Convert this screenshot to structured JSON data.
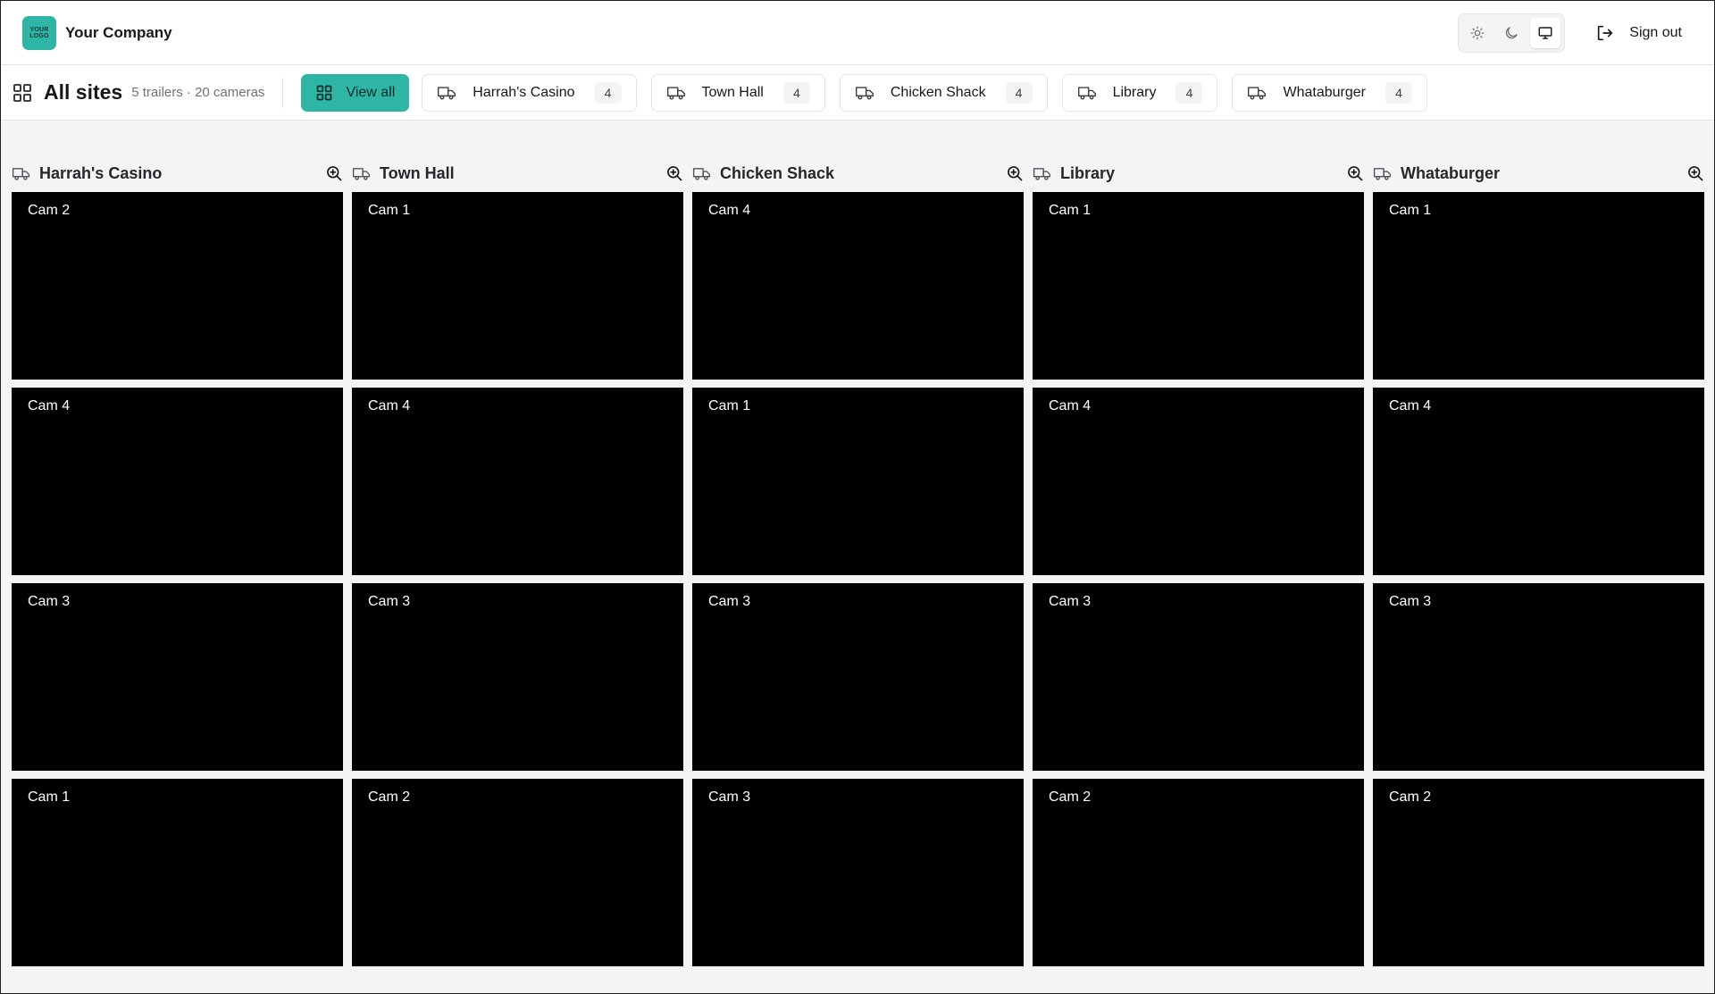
{
  "header": {
    "logo_text": [
      "YOUR",
      "LOGO"
    ],
    "company": "Your Company",
    "theme_options": [
      "light",
      "dark",
      "system"
    ],
    "theme_selected": "system",
    "signout": "Sign out"
  },
  "sitebar": {
    "title": "All sites",
    "subtitle": "5 trailers · 20 cameras",
    "view_all": "View all",
    "sites": [
      {
        "name": "Harrah's Casino",
        "count": "4"
      },
      {
        "name": "Town Hall",
        "count": "4"
      },
      {
        "name": "Chicken Shack",
        "count": "4"
      },
      {
        "name": "Library",
        "count": "4"
      },
      {
        "name": "Whataburger",
        "count": "4"
      }
    ]
  },
  "columns": [
    {
      "name": "Harrah's Casino",
      "cams": [
        "Cam 2",
        "Cam 4",
        "Cam 3",
        "Cam 1"
      ]
    },
    {
      "name": "Town Hall",
      "cams": [
        "Cam 1",
        "Cam 4",
        "Cam 3",
        "Cam 2"
      ]
    },
    {
      "name": "Chicken Shack",
      "cams": [
        "Cam 4",
        "Cam 1",
        "Cam 3",
        "Cam 3"
      ]
    },
    {
      "name": "Library",
      "cams": [
        "Cam 1",
        "Cam 4",
        "Cam 3",
        "Cam 2"
      ]
    },
    {
      "name": "Whataburger",
      "cams": [
        "Cam 1",
        "Cam 4",
        "Cam 3",
        "Cam 2"
      ]
    }
  ],
  "colors": {
    "accent": "#2fb5a6",
    "feed_bg": "#000000"
  }
}
